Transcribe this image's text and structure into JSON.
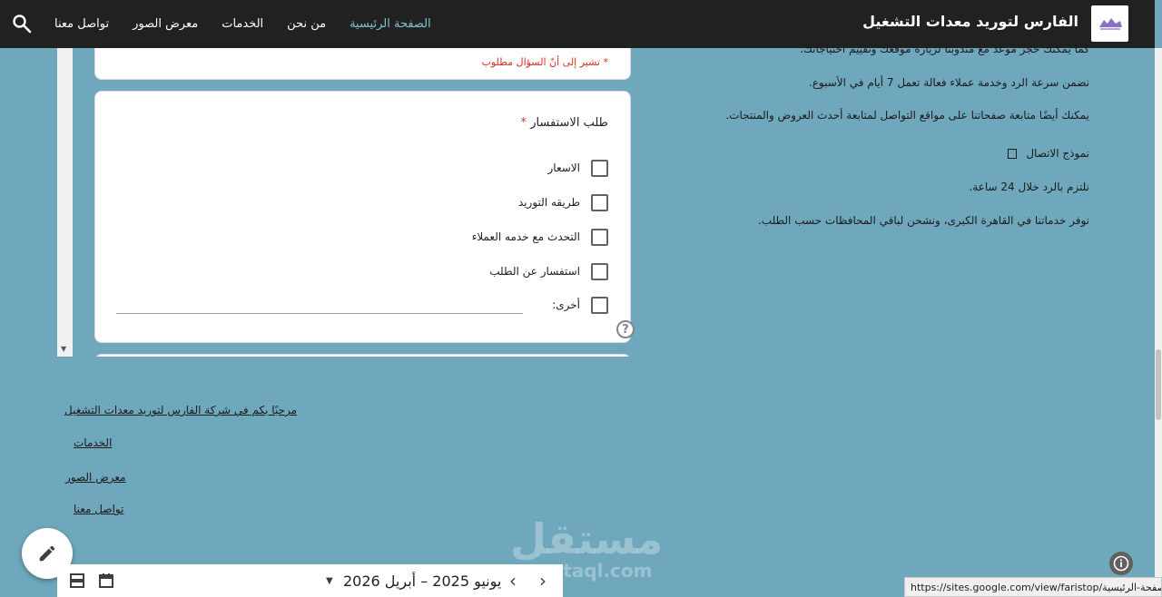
{
  "header": {
    "brand": "الفارس لتوريد معدات التشغيل",
    "nav": [
      {
        "label": "تواصل معنا",
        "active": false
      },
      {
        "label": "معرض الصور",
        "active": false
      },
      {
        "label": "الخدمات",
        "active": false
      },
      {
        "label": "من نحن",
        "active": false
      },
      {
        "label": "الصفحة الرئيسية",
        "active": true
      }
    ],
    "search_icon": "search-icon",
    "logo_icon": "logo-image"
  },
  "form": {
    "required_note": "* تشير إلى أنّ السؤال مطلوب",
    "question_title": "طلب الاستفسار",
    "required_star": "*",
    "options": [
      "الاسعار",
      "طريقه التوريد",
      "التحدث مع خدمه العملاء",
      "استفسار عن الطلب",
      "أخرى:"
    ],
    "help_symbol": "?"
  },
  "info_lines": [
    "كما يمكنك حجز موعد مع مندوبنا لزيارة موقعك وتقييم احتياجاتك.",
    "نضمن سرعة الرد وخدمة عملاء فعالة تعمل 7 أيام في الأسبوع.",
    "يمكنك أيضًا متابعة صفحاتنا على مواقع التواصل لمتابعة أحدث العروض والمنتجات.",
    "نموذج الاتصال",
    "نلتزم بالرد خلال 24 ساعة.",
    "نوفر خدماتنا في القاهرة الكبرى، ونشحن لباقي المحافظات حسب الطلب."
  ],
  "footer_links": [
    "مرحبًا بكم في شركة الفارس لتوريد معدات التشغيل",
    "الخدمات",
    "معرض الصور",
    "تواصل معنا"
  ],
  "calendar": {
    "range": "يونيو 2025 – أبريل 2026"
  },
  "watermark": {
    "ar": "مستقل",
    "en": "mostaql.com"
  },
  "status_url": "https://sites.google.com/view/faristop/الصفحة-الرئيسية"
}
